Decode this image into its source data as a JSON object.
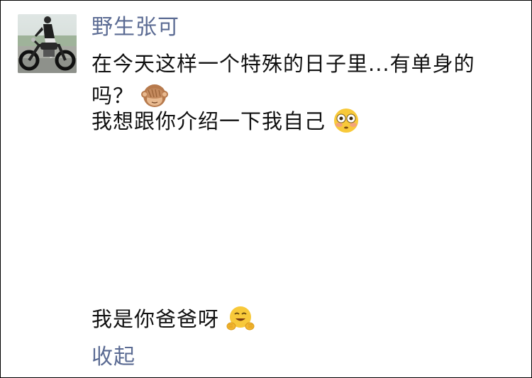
{
  "post": {
    "author": "野生张可",
    "lines": [
      "在今天这样一个特殊的日子里...有单身的",
      "吗？",
      "我想跟你介绍一下我自己",
      "我是你爸爸呀"
    ],
    "emojis": {
      "line2": "see-no-evil-monkey-icon",
      "line3": "flushed-face-icon",
      "line4": "hugging-face-icon"
    },
    "collapse_label": "收起"
  },
  "colors": {
    "link": "#5b6b93",
    "text": "#111111",
    "background": "#ffffff"
  }
}
